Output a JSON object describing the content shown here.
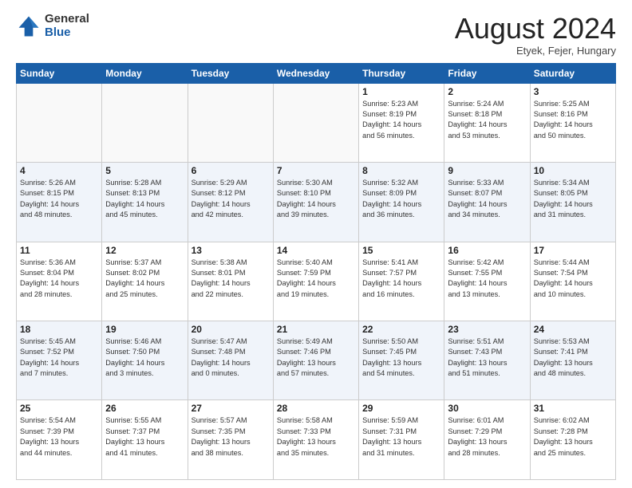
{
  "logo": {
    "general": "General",
    "blue": "Blue"
  },
  "title": "August 2024",
  "location": "Etyek, Fejer, Hungary",
  "days_header": [
    "Sunday",
    "Monday",
    "Tuesday",
    "Wednesday",
    "Thursday",
    "Friday",
    "Saturday"
  ],
  "weeks": [
    {
      "days": [
        {
          "number": "",
          "info": ""
        },
        {
          "number": "",
          "info": ""
        },
        {
          "number": "",
          "info": ""
        },
        {
          "number": "",
          "info": ""
        },
        {
          "number": "1",
          "info": "Sunrise: 5:23 AM\nSunset: 8:19 PM\nDaylight: 14 hours\nand 56 minutes."
        },
        {
          "number": "2",
          "info": "Sunrise: 5:24 AM\nSunset: 8:18 PM\nDaylight: 14 hours\nand 53 minutes."
        },
        {
          "number": "3",
          "info": "Sunrise: 5:25 AM\nSunset: 8:16 PM\nDaylight: 14 hours\nand 50 minutes."
        }
      ]
    },
    {
      "days": [
        {
          "number": "4",
          "info": "Sunrise: 5:26 AM\nSunset: 8:15 PM\nDaylight: 14 hours\nand 48 minutes."
        },
        {
          "number": "5",
          "info": "Sunrise: 5:28 AM\nSunset: 8:13 PM\nDaylight: 14 hours\nand 45 minutes."
        },
        {
          "number": "6",
          "info": "Sunrise: 5:29 AM\nSunset: 8:12 PM\nDaylight: 14 hours\nand 42 minutes."
        },
        {
          "number": "7",
          "info": "Sunrise: 5:30 AM\nSunset: 8:10 PM\nDaylight: 14 hours\nand 39 minutes."
        },
        {
          "number": "8",
          "info": "Sunrise: 5:32 AM\nSunset: 8:09 PM\nDaylight: 14 hours\nand 36 minutes."
        },
        {
          "number": "9",
          "info": "Sunrise: 5:33 AM\nSunset: 8:07 PM\nDaylight: 14 hours\nand 34 minutes."
        },
        {
          "number": "10",
          "info": "Sunrise: 5:34 AM\nSunset: 8:05 PM\nDaylight: 14 hours\nand 31 minutes."
        }
      ]
    },
    {
      "days": [
        {
          "number": "11",
          "info": "Sunrise: 5:36 AM\nSunset: 8:04 PM\nDaylight: 14 hours\nand 28 minutes."
        },
        {
          "number": "12",
          "info": "Sunrise: 5:37 AM\nSunset: 8:02 PM\nDaylight: 14 hours\nand 25 minutes."
        },
        {
          "number": "13",
          "info": "Sunrise: 5:38 AM\nSunset: 8:01 PM\nDaylight: 14 hours\nand 22 minutes."
        },
        {
          "number": "14",
          "info": "Sunrise: 5:40 AM\nSunset: 7:59 PM\nDaylight: 14 hours\nand 19 minutes."
        },
        {
          "number": "15",
          "info": "Sunrise: 5:41 AM\nSunset: 7:57 PM\nDaylight: 14 hours\nand 16 minutes."
        },
        {
          "number": "16",
          "info": "Sunrise: 5:42 AM\nSunset: 7:55 PM\nDaylight: 14 hours\nand 13 minutes."
        },
        {
          "number": "17",
          "info": "Sunrise: 5:44 AM\nSunset: 7:54 PM\nDaylight: 14 hours\nand 10 minutes."
        }
      ]
    },
    {
      "days": [
        {
          "number": "18",
          "info": "Sunrise: 5:45 AM\nSunset: 7:52 PM\nDaylight: 14 hours\nand 7 minutes."
        },
        {
          "number": "19",
          "info": "Sunrise: 5:46 AM\nSunset: 7:50 PM\nDaylight: 14 hours\nand 3 minutes."
        },
        {
          "number": "20",
          "info": "Sunrise: 5:47 AM\nSunset: 7:48 PM\nDaylight: 14 hours\nand 0 minutes."
        },
        {
          "number": "21",
          "info": "Sunrise: 5:49 AM\nSunset: 7:46 PM\nDaylight: 13 hours\nand 57 minutes."
        },
        {
          "number": "22",
          "info": "Sunrise: 5:50 AM\nSunset: 7:45 PM\nDaylight: 13 hours\nand 54 minutes."
        },
        {
          "number": "23",
          "info": "Sunrise: 5:51 AM\nSunset: 7:43 PM\nDaylight: 13 hours\nand 51 minutes."
        },
        {
          "number": "24",
          "info": "Sunrise: 5:53 AM\nSunset: 7:41 PM\nDaylight: 13 hours\nand 48 minutes."
        }
      ]
    },
    {
      "days": [
        {
          "number": "25",
          "info": "Sunrise: 5:54 AM\nSunset: 7:39 PM\nDaylight: 13 hours\nand 44 minutes."
        },
        {
          "number": "26",
          "info": "Sunrise: 5:55 AM\nSunset: 7:37 PM\nDaylight: 13 hours\nand 41 minutes."
        },
        {
          "number": "27",
          "info": "Sunrise: 5:57 AM\nSunset: 7:35 PM\nDaylight: 13 hours\nand 38 minutes."
        },
        {
          "number": "28",
          "info": "Sunrise: 5:58 AM\nSunset: 7:33 PM\nDaylight: 13 hours\nand 35 minutes."
        },
        {
          "number": "29",
          "info": "Sunrise: 5:59 AM\nSunset: 7:31 PM\nDaylight: 13 hours\nand 31 minutes."
        },
        {
          "number": "30",
          "info": "Sunrise: 6:01 AM\nSunset: 7:29 PM\nDaylight: 13 hours\nand 28 minutes."
        },
        {
          "number": "31",
          "info": "Sunrise: 6:02 AM\nSunset: 7:28 PM\nDaylight: 13 hours\nand 25 minutes."
        }
      ]
    }
  ]
}
